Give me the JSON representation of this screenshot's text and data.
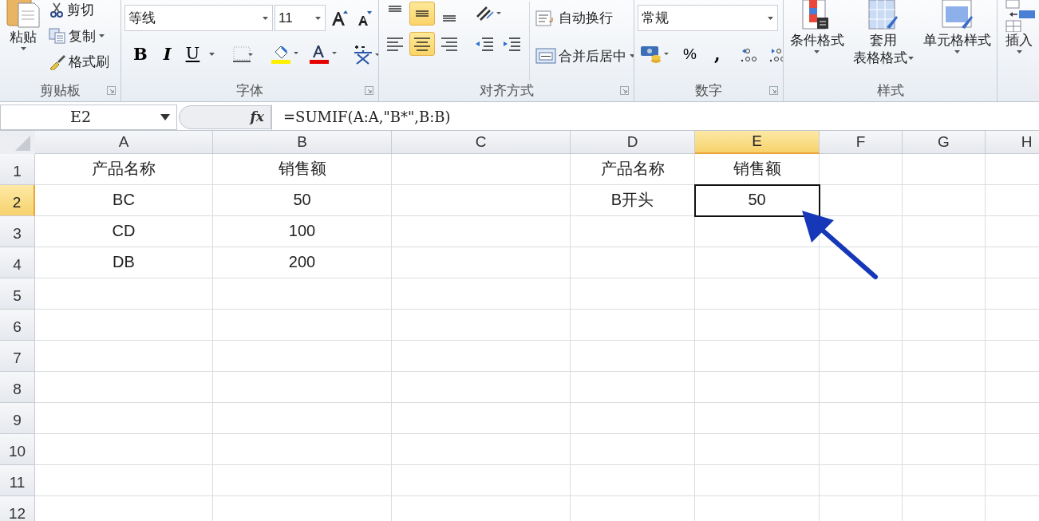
{
  "ribbon": {
    "clipboard": {
      "label": "剪贴板",
      "paste": "粘贴",
      "cut": "剪切",
      "copy": "复制",
      "format_painter": "格式刷"
    },
    "font": {
      "label": "字体",
      "font_name": "等线",
      "font_size": "11",
      "bold": "B",
      "italic": "I",
      "underline": "U"
    },
    "alignment": {
      "label": "对齐方式",
      "vertical": [
        {
          "selected": false
        },
        {
          "selected": true
        },
        {
          "selected": false
        }
      ],
      "horizontal": [
        {
          "selected": false
        },
        {
          "selected": true
        },
        {
          "selected": false
        }
      ],
      "wrap_text": "自动换行",
      "merge_center": "合并后居中"
    },
    "number": {
      "label": "数字",
      "format": "常规",
      "percent": "%",
      "comma": ","
    },
    "styles": {
      "label": "样式",
      "buttons": [
        {
          "lines": [
            "条件格式"
          ]
        },
        {
          "lines": [
            "套用",
            "表格格式"
          ]
        },
        {
          "lines": [
            "单元格样式"
          ]
        }
      ]
    },
    "cells": {
      "insert": "插入"
    }
  },
  "formula_bar": {
    "name_box": "E2",
    "function_label": "fx",
    "formula": "=SUMIF(A:A,\"B*\",B:B)"
  },
  "sheet": {
    "columns": [
      {
        "label": "A",
        "selected": false
      },
      {
        "label": "B",
        "selected": false
      },
      {
        "label": "C",
        "selected": false
      },
      {
        "label": "D",
        "selected": false
      },
      {
        "label": "E",
        "selected": true
      },
      {
        "label": "F",
        "selected": false
      },
      {
        "label": "G",
        "selected": false
      },
      {
        "label": "H",
        "selected": false
      }
    ],
    "rows": [
      {
        "label": "1",
        "selected": false,
        "cells": [
          {
            "text": "产品名称",
            "active": false
          },
          {
            "text": "销售额",
            "active": false
          },
          {
            "text": "",
            "active": false
          },
          {
            "text": "产品名称",
            "active": false
          },
          {
            "text": "销售额",
            "active": false
          }
        ]
      },
      {
        "label": "2",
        "selected": true,
        "cells": [
          {
            "text": "BC",
            "active": false
          },
          {
            "text": "50",
            "active": false
          },
          {
            "text": "",
            "active": false
          },
          {
            "text": "B开头",
            "active": false
          },
          {
            "text": "50",
            "active": true
          }
        ]
      },
      {
        "label": "3",
        "selected": false,
        "cells": [
          {
            "text": "CD",
            "active": false
          },
          {
            "text": "100",
            "active": false
          }
        ]
      },
      {
        "label": "4",
        "selected": false,
        "cells": [
          {
            "text": "DB",
            "active": false
          },
          {
            "text": "200",
            "active": false
          }
        ]
      },
      {
        "label": "5",
        "selected": false,
        "cells": []
      },
      {
        "label": "6",
        "selected": false,
        "cells": []
      },
      {
        "label": "7",
        "selected": false,
        "cells": []
      },
      {
        "label": "8",
        "selected": false,
        "cells": []
      },
      {
        "label": "9",
        "selected": false,
        "cells": []
      },
      {
        "label": "10",
        "selected": false,
        "cells": []
      },
      {
        "label": "11",
        "selected": false,
        "cells": []
      },
      {
        "label": "12",
        "selected": false,
        "cells": []
      }
    ]
  }
}
